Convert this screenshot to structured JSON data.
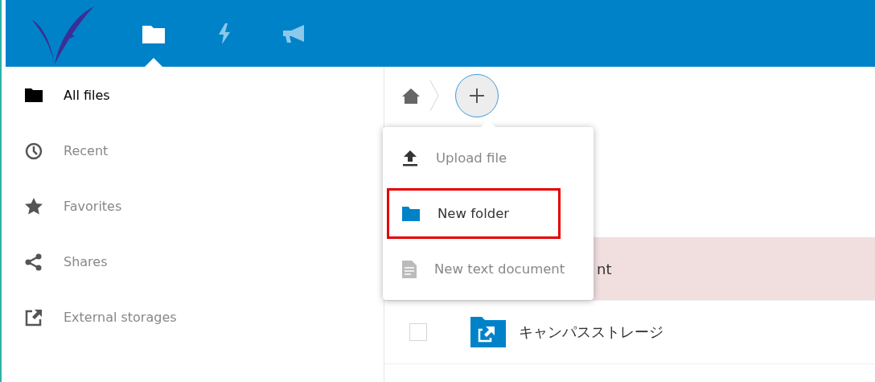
{
  "header": {
    "apps": [
      {
        "kind": "files",
        "selected": true
      },
      {
        "kind": "activity",
        "selected": false
      },
      {
        "kind": "announcements",
        "selected": false
      }
    ]
  },
  "sidebar": {
    "items": [
      {
        "kind": "folder",
        "label": "All files",
        "selected": true
      },
      {
        "kind": "clock",
        "label": "Recent",
        "selected": false
      },
      {
        "kind": "star",
        "label": "Favorites",
        "selected": false
      },
      {
        "kind": "share",
        "label": "Shares",
        "selected": false
      },
      {
        "kind": "external",
        "label": "External storages",
        "selected": false
      }
    ]
  },
  "new_menu": {
    "items": [
      {
        "kind": "upload",
        "label": "Upload file",
        "highlighted": false
      },
      {
        "kind": "folder",
        "label": "New folder",
        "highlighted": true
      },
      {
        "kind": "text",
        "label": "New text document",
        "highlighted": false
      }
    ]
  },
  "files": [
    {
      "kind": "covered",
      "name": "nt",
      "highlighted": true
    },
    {
      "kind": "external_folder",
      "name": "キャンパスストレージ",
      "highlighted": false
    }
  ]
}
